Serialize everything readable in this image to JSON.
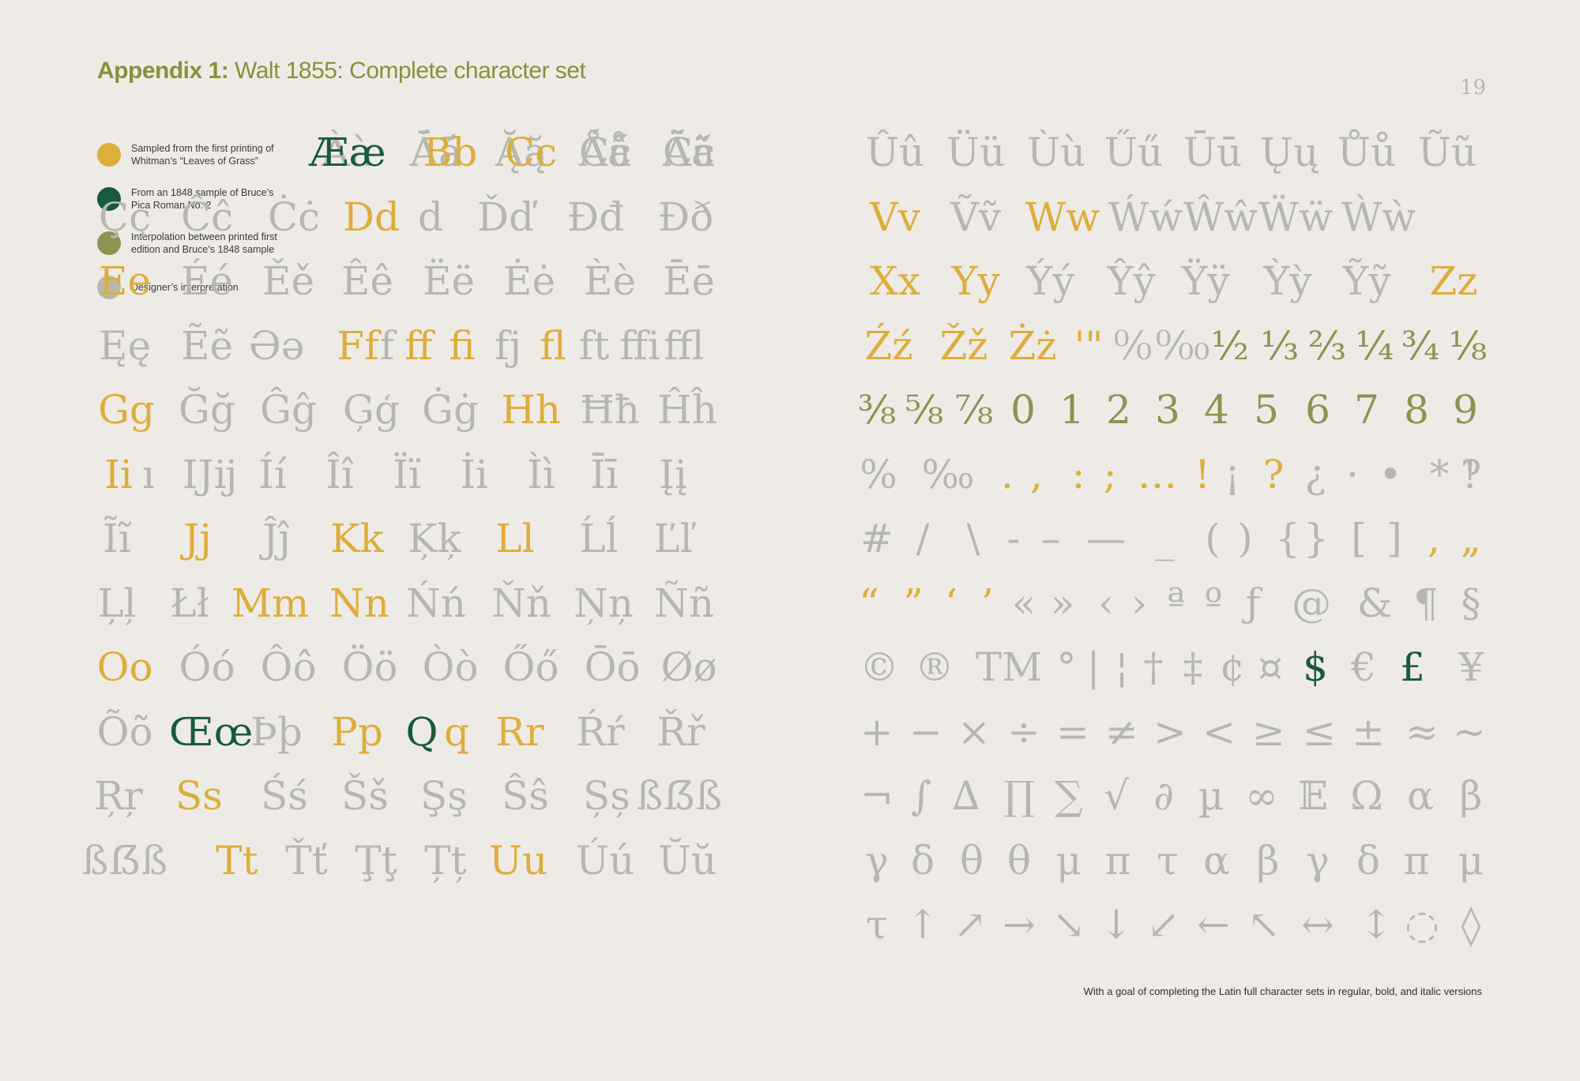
{
  "header": {
    "bold": "Appendix 1:",
    "rest": " Walt 1855: Complete character set"
  },
  "page_number": "19",
  "footnote": "With a goal of completing the Latin full character sets in regular, bold, and italic versions",
  "colors": {
    "yellow": "#dcae3a",
    "green": "#175a3e",
    "olive": "#8f9152",
    "grey": "#b6b8ae",
    "background": "#eeebe7",
    "heading": "#8b8f3a"
  },
  "legend": [
    {
      "color": "yellow",
      "text": "Sampled from the first printing of Whitman’s “Leaves of Grass”"
    },
    {
      "color": "green",
      "text": "From an 1848 sample of Bruce’s Pica Roman No. 2"
    },
    {
      "color": "olive",
      "text": "Interpolation between printed first edition and Bruce’s 1848 sample"
    },
    {
      "color": "grey",
      "text": "Designer’s interpretation"
    }
  ],
  "left_rows": [
    [
      [
        "Aa",
        "yellow"
      ],
      [
        "Áá",
        "grey"
      ],
      [
        "Ăă",
        "grey"
      ],
      [
        "Ââ",
        "grey"
      ],
      [
        "Ää",
        "grey"
      ]
    ],
    [
      [
        "Àà",
        "grey"
      ],
      [
        "Āā",
        "grey"
      ],
      [
        "Ąą",
        "grey"
      ],
      [
        "Åå",
        "grey"
      ],
      [
        "Ãã",
        "grey"
      ]
    ],
    [
      [
        "Ææ",
        "green"
      ],
      [
        "Bb",
        "yellow"
      ],
      [
        "Cc",
        "yellow"
      ],
      [
        "Ćć",
        "grey"
      ],
      [
        "Čč",
        "grey"
      ]
    ],
    [
      [
        "Çç",
        "grey"
      ],
      [
        "Ĉĉ",
        "grey"
      ],
      [
        "Ċċ",
        "grey"
      ],
      [
        "Dd",
        "yellow"
      ],
      [
        "d",
        "grey"
      ],
      [
        "Ďď",
        "grey"
      ],
      [
        "Đđ",
        "grey"
      ],
      [
        "Ðð",
        "grey"
      ]
    ],
    [
      [
        "Ee",
        "yellow"
      ],
      [
        "Éé",
        "grey"
      ],
      [
        "Ěě",
        "grey"
      ],
      [
        "Êê",
        "grey"
      ],
      [
        "Ëë",
        "grey"
      ],
      [
        "Ėė",
        "grey"
      ],
      [
        "Èè",
        "grey"
      ],
      [
        "Ēē",
        "grey"
      ]
    ],
    [
      [
        "Ęę",
        "grey"
      ],
      [
        "Ẽẽ",
        "grey"
      ],
      [
        "Əə",
        "grey"
      ],
      [
        "Ff",
        "yellow"
      ],
      [
        "f",
        "grey"
      ],
      [
        "ff",
        "yellow"
      ],
      [
        "fi",
        "yellow"
      ],
      [
        "fj",
        "grey"
      ],
      [
        "fl",
        "yellow"
      ],
      [
        "ft",
        "grey"
      ],
      [
        "ffi",
        "grey"
      ],
      [
        "ffl",
        "grey"
      ]
    ],
    [
      [
        "Gg",
        "yellow"
      ],
      [
        "Ğğ",
        "grey"
      ],
      [
        "Ĝĝ",
        "grey"
      ],
      [
        "Ģģ",
        "grey"
      ],
      [
        "Ġġ",
        "grey"
      ],
      [
        "Hh",
        "yellow"
      ],
      [
        "Ħħ",
        "grey"
      ],
      [
        "Ĥĥ",
        "grey"
      ]
    ],
    [
      [
        "Ii",
        "yellow"
      ],
      [
        "ı",
        "grey"
      ],
      [
        "Ĳĳ",
        "grey"
      ],
      [
        "Íí",
        "grey"
      ],
      [
        "Îî",
        "grey"
      ],
      [
        "Ïï",
        "grey"
      ],
      [
        "İi",
        "grey"
      ],
      [
        "Ìì",
        "grey"
      ],
      [
        "Īī",
        "grey"
      ],
      [
        "Įį",
        "grey"
      ]
    ],
    [
      [
        "Ĩĩ",
        "grey"
      ],
      [
        "Jj",
        "yellow"
      ],
      [
        "Ĵĵ",
        "grey"
      ],
      [
        "Kk",
        "yellow"
      ],
      [
        "Ķķ",
        "grey"
      ],
      [
        "Ll",
        "yellow"
      ],
      [
        "Ĺĺ",
        "grey"
      ],
      [
        "Ľľ",
        "grey"
      ]
    ],
    [
      [
        "Ļļ",
        "grey"
      ],
      [
        "Łł",
        "grey"
      ],
      [
        "Mm",
        "yellow"
      ],
      [
        "Nn",
        "yellow"
      ],
      [
        "Ńń",
        "grey"
      ],
      [
        "Ňň",
        "grey"
      ],
      [
        "Ņņ",
        "grey"
      ],
      [
        "Ññ",
        "grey"
      ]
    ],
    [
      [
        "Oo",
        "yellow"
      ],
      [
        "Óó",
        "grey"
      ],
      [
        "Ôô",
        "grey"
      ],
      [
        "Öö",
        "grey"
      ],
      [
        "Òò",
        "grey"
      ],
      [
        "Őő",
        "grey"
      ],
      [
        "Ōō",
        "grey"
      ],
      [
        "Øø",
        "grey"
      ]
    ],
    [
      [
        "Õõ",
        "grey"
      ],
      [
        "Œœ",
        "green"
      ],
      [
        "Þþ",
        "grey"
      ],
      [
        "Pp",
        "yellow"
      ],
      [
        "Q",
        "green"
      ],
      [
        "q",
        "yellow"
      ],
      [
        "Rr",
        "yellow"
      ],
      [
        "Ŕŕ",
        "grey"
      ],
      [
        "Řř",
        "grey"
      ]
    ],
    [
      [
        "Ŗŗ",
        "grey"
      ],
      [
        "Ss",
        "yellow"
      ],
      [
        "Śś",
        "grey"
      ],
      [
        "Šš",
        "grey"
      ],
      [
        "Şş",
        "grey"
      ],
      [
        "Ŝŝ",
        "grey"
      ],
      [
        "Șș",
        "grey"
      ],
      [
        "ßẞß",
        "grey"
      ]
    ],
    [
      [
        "ßẞß",
        "grey"
      ],
      [
        "Tt",
        "yellow"
      ],
      [
        "Ťť",
        "grey"
      ],
      [
        "Ţţ",
        "grey"
      ],
      [
        "Țț",
        "grey"
      ],
      [
        "Uu",
        "yellow"
      ],
      [
        "Úú",
        "grey"
      ],
      [
        "Ŭŭ",
        "grey"
      ]
    ]
  ],
  "right_rows": [
    [
      [
        "Ûû",
        "grey"
      ],
      [
        "Üü",
        "grey"
      ],
      [
        "Ùù",
        "grey"
      ],
      [
        "Űű",
        "grey"
      ],
      [
        "Ūū",
        "grey"
      ],
      [
        "Ųų",
        "grey"
      ],
      [
        "Ůů",
        "grey"
      ],
      [
        "Ũũ",
        "grey"
      ]
    ],
    [
      [
        "Vv",
        "yellow"
      ],
      [
        "Ṽṽ",
        "grey"
      ],
      [
        "Ww",
        "yellow"
      ],
      [
        "Ẃẃ",
        "grey"
      ],
      [
        "Ŵŵ",
        "grey"
      ],
      [
        "Ẅẅ",
        "grey"
      ],
      [
        "Ẁẁ",
        "grey"
      ]
    ],
    [
      [
        "Xx",
        "yellow"
      ],
      [
        "Yy",
        "yellow"
      ],
      [
        "Ýý",
        "grey"
      ],
      [
        "Ŷŷ",
        "grey"
      ],
      [
        "Ÿÿ",
        "grey"
      ],
      [
        "Ỳỳ",
        "grey"
      ],
      [
        "Ỹỹ",
        "grey"
      ],
      [
        "Zz",
        "yellow"
      ]
    ],
    [
      [
        "Źź",
        "yellow"
      ],
      [
        "Žž",
        "yellow"
      ],
      [
        "Żż",
        "yellow"
      ],
      [
        "'\"",
        "yellow"
      ],
      [
        "⁰⁄₀",
        "grey"
      ],
      [
        "⁰⁄₀₀",
        "grey"
      ],
      [
        "½",
        "olive"
      ],
      [
        "⅓",
        "olive"
      ],
      [
        "⅔",
        "olive"
      ],
      [
        "¼",
        "olive"
      ],
      [
        "¾",
        "olive"
      ],
      [
        "⅛",
        "olive"
      ]
    ],
    [
      [
        "⅜",
        "olive"
      ],
      [
        "⅝",
        "olive"
      ],
      [
        "⅞",
        "olive"
      ],
      [
        "0",
        "olive"
      ],
      [
        "1",
        "olive"
      ],
      [
        "2",
        "olive"
      ],
      [
        "3",
        "olive"
      ],
      [
        "4",
        "olive"
      ],
      [
        "5",
        "olive"
      ],
      [
        "6",
        "olive"
      ],
      [
        "7",
        "olive"
      ],
      [
        "8",
        "olive"
      ],
      [
        "9",
        "olive"
      ]
    ],
    [
      [
        "%",
        "grey"
      ],
      [
        "‰",
        "grey"
      ],
      [
        ".",
        "yellow"
      ],
      [
        ",",
        "yellow"
      ],
      [
        ":",
        "yellow"
      ],
      [
        ";",
        "yellow"
      ],
      [
        "…",
        "yellow"
      ],
      [
        "!",
        "yellow"
      ],
      [
        "¡",
        "grey"
      ],
      [
        "?",
        "yellow"
      ],
      [
        "¿",
        "grey"
      ],
      [
        "·",
        "grey"
      ],
      [
        "•",
        "grey"
      ],
      [
        "*",
        "grey"
      ],
      [
        "‽",
        "grey"
      ]
    ],
    [
      [
        "#",
        "grey"
      ],
      [
        "/",
        "grey"
      ],
      [
        "\\",
        "grey"
      ],
      [
        "-",
        "grey"
      ],
      [
        "–",
        "grey"
      ],
      [
        "—",
        "grey"
      ],
      [
        "_",
        "grey"
      ],
      [
        "(",
        "grey"
      ],
      [
        ")",
        "grey"
      ],
      [
        "{",
        "grey"
      ],
      [
        "}",
        "grey"
      ],
      [
        "[",
        "grey"
      ],
      [
        "]",
        "grey"
      ],
      [
        ",",
        "yellow"
      ],
      [
        "„",
        "yellow"
      ]
    ],
    [
      [
        "“",
        "yellow"
      ],
      [
        "”",
        "yellow"
      ],
      [
        "‘",
        "yellow"
      ],
      [
        "’",
        "yellow"
      ],
      [
        "«",
        "grey"
      ],
      [
        "»",
        "grey"
      ],
      [
        "‹",
        "grey"
      ],
      [
        "›",
        "grey"
      ],
      [
        "ª",
        "grey"
      ],
      [
        "º",
        "grey"
      ],
      [
        "ƒ",
        "grey"
      ],
      [
        "@",
        "grey"
      ],
      [
        "&",
        "grey"
      ],
      [
        "¶",
        "grey"
      ],
      [
        "§",
        "grey"
      ]
    ],
    [
      [
        "©",
        "grey"
      ],
      [
        "®",
        "grey"
      ],
      [
        "TM",
        "grey"
      ],
      [
        "°",
        "grey"
      ],
      [
        "|",
        "grey"
      ],
      [
        "¦",
        "grey"
      ],
      [
        "†",
        "grey"
      ],
      [
        "‡",
        "grey"
      ],
      [
        "¢",
        "grey"
      ],
      [
        "¤",
        "grey"
      ],
      [
        "$",
        "green"
      ],
      [
        "€",
        "grey"
      ],
      [
        "£",
        "green"
      ],
      [
        "¥",
        "grey"
      ]
    ],
    [
      [
        "+",
        "grey"
      ],
      [
        "−",
        "grey"
      ],
      [
        "×",
        "grey"
      ],
      [
        "÷",
        "grey"
      ],
      [
        "=",
        "grey"
      ],
      [
        "≠",
        "grey"
      ],
      [
        ">",
        "grey"
      ],
      [
        "<",
        "grey"
      ],
      [
        "≥",
        "grey"
      ],
      [
        "≤",
        "grey"
      ],
      [
        "±",
        "grey"
      ],
      [
        "≈",
        "grey"
      ],
      [
        "~",
        "grey"
      ]
    ],
    [
      [
        "¬",
        "grey"
      ],
      [
        "∫",
        "grey"
      ],
      [
        "∆",
        "grey"
      ],
      [
        "∏",
        "grey"
      ],
      [
        "∑",
        "grey"
      ],
      [
        "√",
        "grey"
      ],
      [
        "∂",
        "grey"
      ],
      [
        "µ",
        "grey"
      ],
      [
        "∞",
        "grey"
      ],
      [
        "𝔼",
        "grey"
      ],
      [
        "Ω",
        "grey"
      ],
      [
        "α",
        "grey"
      ],
      [
        "β",
        "grey"
      ]
    ],
    [
      [
        "γ",
        "grey"
      ],
      [
        "δ",
        "grey"
      ],
      [
        "θ",
        "grey"
      ],
      [
        "θ",
        "grey"
      ],
      [
        "μ",
        "grey"
      ],
      [
        "π",
        "grey"
      ],
      [
        "τ",
        "grey"
      ],
      [
        "α",
        "grey"
      ],
      [
        "β",
        "grey"
      ],
      [
        "γ",
        "grey"
      ],
      [
        "δ",
        "grey"
      ],
      [
        "π",
        "grey"
      ],
      [
        "μ",
        "grey"
      ]
    ],
    [
      [
        "τ",
        "grey"
      ],
      [
        "↑",
        "grey"
      ],
      [
        "↗",
        "grey"
      ],
      [
        "→",
        "grey"
      ],
      [
        "↘",
        "grey"
      ],
      [
        "↓",
        "grey"
      ],
      [
        "↙",
        "grey"
      ],
      [
        "←",
        "grey"
      ],
      [
        "↖",
        "grey"
      ],
      [
        "↔",
        "grey"
      ],
      [
        "↕",
        "grey"
      ],
      [
        "◌",
        "grey"
      ],
      [
        "◊",
        "grey"
      ]
    ]
  ]
}
